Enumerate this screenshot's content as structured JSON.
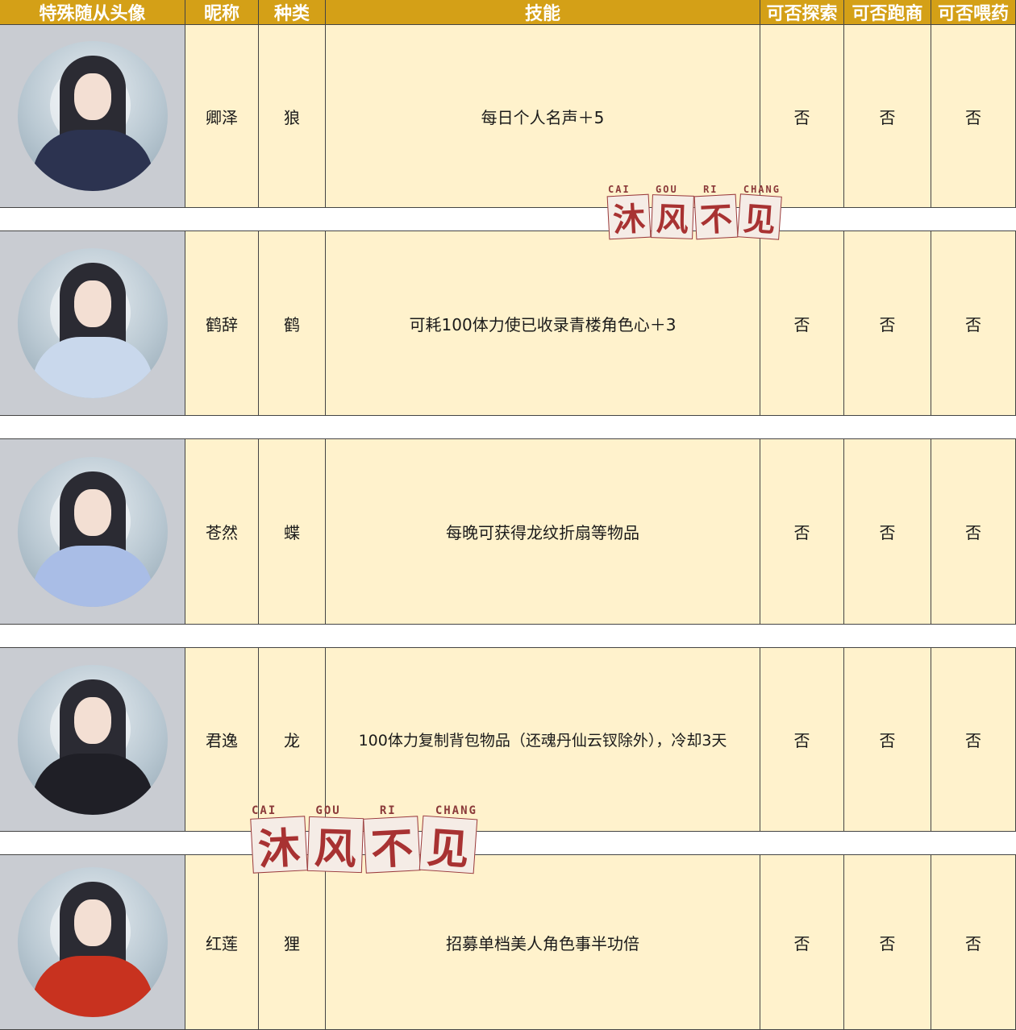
{
  "header": {
    "avatar": "特殊随从头像",
    "nickname": "昵称",
    "type": "种类",
    "skill": "技能",
    "explore": "可否探索",
    "trade": "可否跑商",
    "feed": "可否喂药"
  },
  "rows": [
    {
      "nickname": "卿泽",
      "type": "狼",
      "skill": "每日个人名声＋5",
      "explore": "否",
      "trade": "否",
      "feed": "否"
    },
    {
      "nickname": "鹤辞",
      "type": "鹤",
      "skill": "可耗100体力使已收录青楼角色心＋3",
      "explore": "否",
      "trade": "否",
      "feed": "否"
    },
    {
      "nickname": "苍然",
      "type": "蝶",
      "skill": "每晚可获得龙纹折扇等物品",
      "explore": "否",
      "trade": "否",
      "feed": "否"
    },
    {
      "nickname": "君逸",
      "type": "龙",
      "skill": "100体力复制背包物品（还魂丹仙云钗除外），冷却3天",
      "explore": "否",
      "trade": "否",
      "feed": "否"
    },
    {
      "nickname": "红莲",
      "type": "狸",
      "skill": "招募单档美人角色事半功倍",
      "explore": "否",
      "trade": "否",
      "feed": "否"
    }
  ],
  "watermark": {
    "pinyin": [
      "CAI",
      "GOU",
      "RI",
      "CHANG"
    ],
    "chars": [
      "沐",
      "风",
      "不",
      "见"
    ]
  },
  "colors": {
    "header_bg": "#d4a017",
    "cell_bg": "#fff2cc",
    "watermark": "#a83232"
  }
}
